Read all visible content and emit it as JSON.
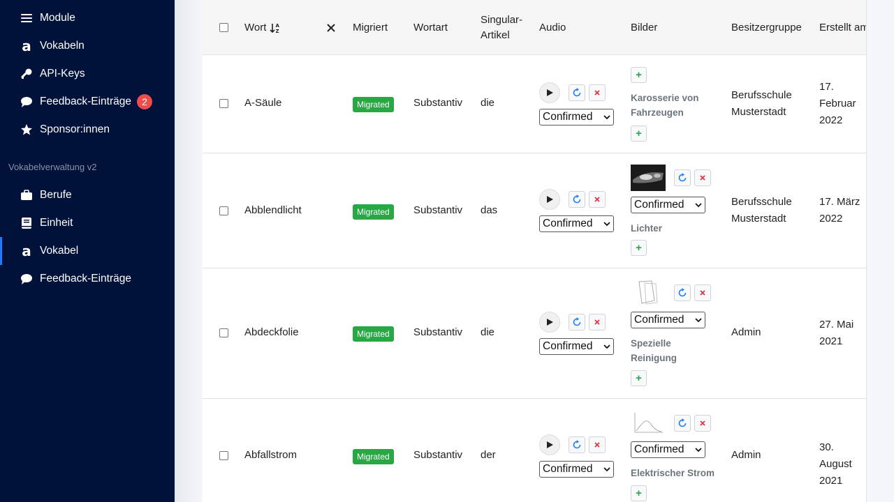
{
  "sidebar": {
    "items": [
      {
        "label": "Module",
        "icon": "menu-icon"
      },
      {
        "label": "Vokabeln",
        "icon": "letter-a-icon"
      },
      {
        "label": "API-Keys",
        "icon": "key-icon"
      },
      {
        "label": "Feedback-Einträge",
        "icon": "chat-bubble-icon",
        "badge": "2"
      },
      {
        "label": "Sponsor:innen",
        "icon": "star-icon"
      }
    ],
    "section_label": "Vokabelverwaltung v2",
    "section_items": [
      {
        "label": "Berufe",
        "icon": "briefcase-icon"
      },
      {
        "label": "Einheit",
        "icon": "book-icon"
      },
      {
        "label": "Vokabel",
        "icon": "letter-a-icon",
        "active": true
      },
      {
        "label": "Feedback-Einträge",
        "icon": "chat-bubble-icon"
      }
    ]
  },
  "table": {
    "headers": {
      "word": "Wort",
      "migrated": "Migriert",
      "word_type": "Wortart",
      "article": "Singular-Artikel",
      "audio": "Audio",
      "images": "Bilder",
      "owner": "Besitzergruppe",
      "created": "Erstellt am"
    },
    "rows": [
      {
        "word": "A-Säule",
        "migrated": "Migrated",
        "word_type": "Substantiv",
        "article": "die",
        "audio_status": "Confirmed",
        "image_status": "",
        "category": "Karosserie von Fahrzeugen",
        "owner": "Berufsschule Musterstadt",
        "created": "17. Februar 2022"
      },
      {
        "word": "Abblendlicht",
        "migrated": "Migrated",
        "word_type": "Substantiv",
        "article": "das",
        "audio_status": "Confirmed",
        "image_status": "Confirmed",
        "category": "Lichter",
        "owner": "Berufsschule Musterstadt",
        "created": "17. März 2022"
      },
      {
        "word": "Abdeckfolie",
        "migrated": "Migrated",
        "word_type": "Substantiv",
        "article": "die",
        "audio_status": "Confirmed",
        "image_status": "Confirmed",
        "category": "Spezielle Reinigung",
        "owner": "Admin",
        "created": "27. Mai 2021"
      },
      {
        "word": "Abfallstrom",
        "migrated": "Migrated",
        "word_type": "Substantiv",
        "article": "der",
        "audio_status": "Confirmed",
        "image_status": "Confirmed",
        "category": "Elektrischer Strom",
        "owner": "Admin",
        "created": "30. August 2021"
      }
    ]
  },
  "colors": {
    "sidebar_bg": "#00113a",
    "badge_red": "#ef4b4b",
    "migrated_green": "#28a745",
    "active_blue": "#1e7bff"
  }
}
